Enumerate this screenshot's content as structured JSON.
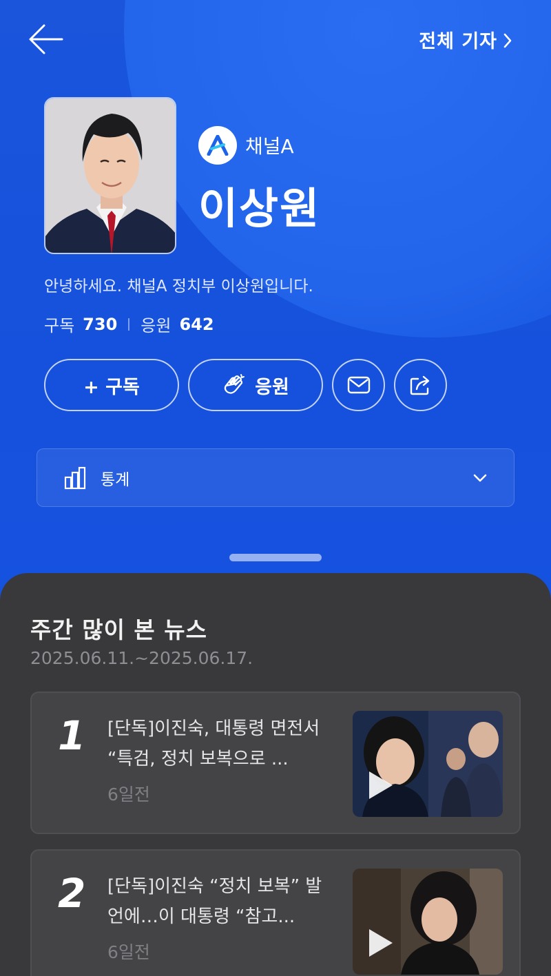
{
  "header": {
    "back_icon": "arrow-left-icon",
    "all_reporters_label": "전체 기자"
  },
  "profile": {
    "channel_name": "채널A",
    "reporter_name": "이상원",
    "intro": "안녕하세요. 채널A 정치부 이상원입니다.",
    "subscribe_label": "구독",
    "subscribe_count": "730",
    "cheer_label": "응원",
    "cheer_count": "642"
  },
  "actions": {
    "subscribe_button": "+ 구독",
    "cheer_button": "응원",
    "mail_icon": "envelope-icon",
    "share_icon": "share-icon"
  },
  "stats_panel": {
    "label": "통계",
    "icon": "bar-chart-icon"
  },
  "weekly": {
    "title": "주간 많이 본 뉴스",
    "date_range": "2025.06.11.~2025.06.17.",
    "items": [
      {
        "rank": "1",
        "headline": "[단독]이진숙, 대통령 면전서 “특검, 정치 보복으로 ...",
        "time": "6일전"
      },
      {
        "rank": "2",
        "headline": "[단독]이진숙 “정치 보복” 발언에…이 대통령 “참고...",
        "time": "6일전"
      }
    ]
  },
  "colors": {
    "hero_blue": "#1551dc",
    "sheet_dark": "#39393c",
    "card_dark": "#444447"
  }
}
